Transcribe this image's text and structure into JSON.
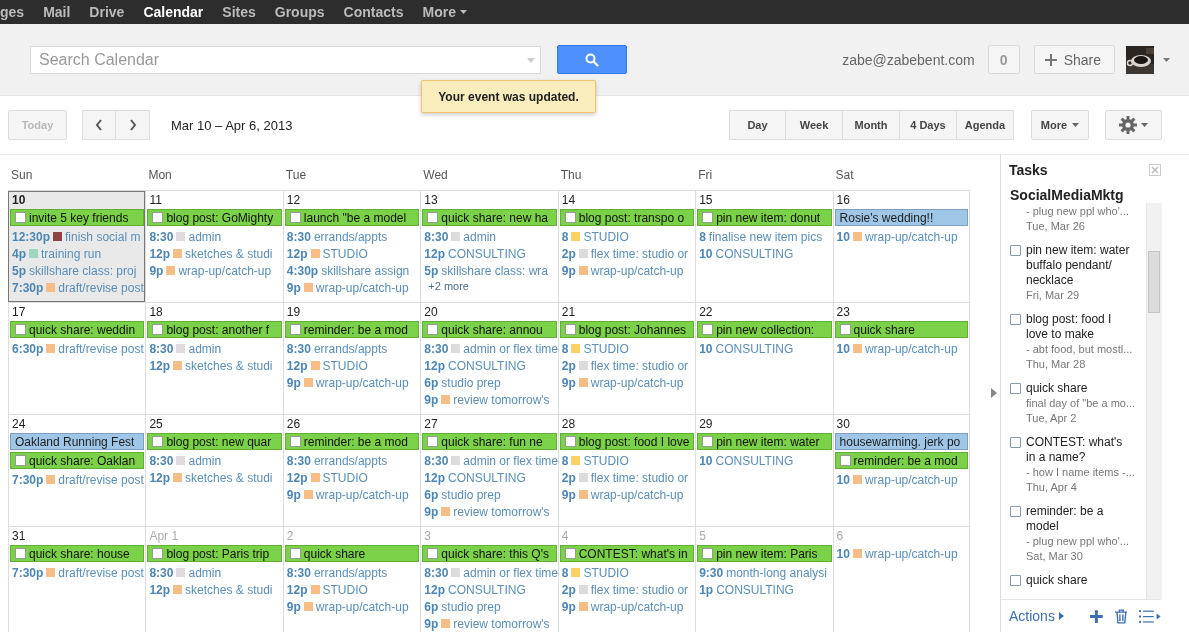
{
  "nav": [
    {
      "label": "ges",
      "selected": false
    },
    {
      "label": "Mail",
      "selected": false
    },
    {
      "label": "Drive",
      "selected": false
    },
    {
      "label": "Calendar",
      "selected": true
    },
    {
      "label": "Sites",
      "selected": false
    },
    {
      "label": "Groups",
      "selected": false
    },
    {
      "label": "Contacts",
      "selected": false
    },
    {
      "label": "More",
      "selected": false
    }
  ],
  "header": {
    "search_placeholder": "Search Calendar",
    "email": "zabe@zabebent.com",
    "notifications": "0",
    "share": "Share",
    "toast": "Your event was updated."
  },
  "toolbar": {
    "today": {
      "label": "Today",
      "disabled": true
    },
    "date_range": "Mar 10 – Apr 6, 2013",
    "views": [
      "Day",
      "Week",
      "Month",
      "4 Days",
      "Agenda"
    ],
    "more": "More"
  },
  "weekdays": [
    "Sun",
    "Mon",
    "Tue",
    "Wed",
    "Thu",
    "Fri",
    "Sat"
  ],
  "weeks": [
    {
      "days": [
        {
          "date": "10",
          "today": true,
          "other_month": false,
          "events": [
            {
              "kind": "task",
              "text": "invite 5 key friends"
            },
            {
              "kind": "timed",
              "time": "12:30p",
              "text": "finish social m",
              "color": "#8e4343"
            },
            {
              "kind": "timed",
              "time": "4p",
              "text": "training run",
              "color": "#9fd6c2"
            },
            {
              "kind": "timed",
              "time": "5p",
              "text": "skillshare class: proj"
            },
            {
              "kind": "timed",
              "time": "7:30p",
              "text": "draft/revise post",
              "color": "#f6bd86"
            }
          ]
        },
        {
          "date": "11",
          "today": false,
          "other_month": false,
          "events": [
            {
              "kind": "task",
              "text": "blog post: GoMighty"
            },
            {
              "kind": "timed",
              "time": "8:30",
              "text": "admin",
              "color": "#dcdcdc"
            },
            {
              "kind": "timed",
              "time": "12p",
              "text": "sketches & studi",
              "color": "#f6bd86"
            },
            {
              "kind": "timed",
              "time": "9p",
              "text": "wrap-up/catch-up",
              "color": "#f6bd86"
            }
          ]
        },
        {
          "date": "12",
          "today": false,
          "other_month": false,
          "events": [
            {
              "kind": "task",
              "text": "launch \"be a model"
            },
            {
              "kind": "timed",
              "time": "8:30",
              "text": "errands/appts"
            },
            {
              "kind": "timed",
              "time": "12p",
              "text": "STUDIO",
              "color": "#f6bd86"
            },
            {
              "kind": "timed",
              "time": "4:30p",
              "text": "skillshare assign"
            },
            {
              "kind": "timed",
              "time": "9p",
              "text": "wrap-up/catch-up",
              "color": "#f6bd86"
            }
          ]
        },
        {
          "date": "13",
          "today": false,
          "other_month": false,
          "events": [
            {
              "kind": "task",
              "text": "quick share: new ha"
            },
            {
              "kind": "timed",
              "time": "8:30",
              "text": "admin",
              "color": "#dcdcdc"
            },
            {
              "kind": "timed",
              "time": "12p",
              "text": "CONSULTING"
            },
            {
              "kind": "timed",
              "time": "5p",
              "text": "skillshare class: wra"
            },
            {
              "kind": "more",
              "text": "+2 more"
            }
          ]
        },
        {
          "date": "14",
          "today": false,
          "other_month": false,
          "events": [
            {
              "kind": "task",
              "text": "blog post: transpo o"
            },
            {
              "kind": "timed",
              "time": "8",
              "text": "STUDIO",
              "color": "#fad165"
            },
            {
              "kind": "timed",
              "time": "2p",
              "text": "flex time: studio or",
              "color": "#dcdcdc"
            },
            {
              "kind": "timed",
              "time": "9p",
              "text": "wrap-up/catch-up",
              "color": "#f6bd86"
            }
          ]
        },
        {
          "date": "15",
          "today": false,
          "other_month": false,
          "events": [
            {
              "kind": "task",
              "text": "pin new item: donut"
            },
            {
              "kind": "timed",
              "time": "8",
              "text": "finalise new item pics"
            },
            {
              "kind": "timed",
              "time": "10",
              "text": "CONSULTING"
            }
          ]
        },
        {
          "date": "16",
          "today": false,
          "other_month": false,
          "events": [
            {
              "kind": "allday",
              "text": "Rosie's wedding!!"
            },
            {
              "kind": "timed",
              "time": "10",
              "text": "wrap-up/catch-up",
              "color": "#f6bd86"
            }
          ]
        }
      ]
    },
    {
      "days": [
        {
          "date": "17",
          "today": false,
          "other_month": false,
          "events": [
            {
              "kind": "task",
              "text": "quick share: weddin"
            },
            {
              "kind": "timed",
              "time": "6:30p",
              "text": "draft/revise post",
              "color": "#f6bd86"
            }
          ]
        },
        {
          "date": "18",
          "today": false,
          "other_month": false,
          "events": [
            {
              "kind": "task",
              "text": "blog post: another f"
            },
            {
              "kind": "timed",
              "time": "8:30",
              "text": "admin",
              "color": "#dcdcdc"
            },
            {
              "kind": "timed",
              "time": "12p",
              "text": "sketches & studi",
              "color": "#f6bd86"
            }
          ]
        },
        {
          "date": "19",
          "today": false,
          "other_month": false,
          "events": [
            {
              "kind": "task",
              "text": "reminder: be a mod"
            },
            {
              "kind": "timed",
              "time": "8:30",
              "text": "errands/appts"
            },
            {
              "kind": "timed",
              "time": "12p",
              "text": "STUDIO",
              "color": "#f6bd86"
            },
            {
              "kind": "timed",
              "time": "9p",
              "text": "wrap-up/catch-up",
              "color": "#f6bd86"
            }
          ]
        },
        {
          "date": "20",
          "today": false,
          "other_month": false,
          "events": [
            {
              "kind": "task",
              "text": "quick share: annou"
            },
            {
              "kind": "timed",
              "time": "8:30",
              "text": "admin or flex time",
              "color": "#dcdcdc"
            },
            {
              "kind": "timed",
              "time": "12p",
              "text": "CONSULTING"
            },
            {
              "kind": "timed",
              "time": "6p",
              "text": "studio prep"
            },
            {
              "kind": "timed",
              "time": "9p",
              "text": "review tomorrow's",
              "color": "#f6bd86"
            }
          ]
        },
        {
          "date": "21",
          "today": false,
          "other_month": false,
          "events": [
            {
              "kind": "task",
              "text": "blog post: Johannes"
            },
            {
              "kind": "timed",
              "time": "8",
              "text": "STUDIO",
              "color": "#fad165"
            },
            {
              "kind": "timed",
              "time": "2p",
              "text": "flex time: studio or",
              "color": "#dcdcdc"
            },
            {
              "kind": "timed",
              "time": "9p",
              "text": "wrap-up/catch-up",
              "color": "#f6bd86"
            }
          ]
        },
        {
          "date": "22",
          "today": false,
          "other_month": false,
          "events": [
            {
              "kind": "task",
              "text": "pin new collection:"
            },
            {
              "kind": "timed",
              "time": "10",
              "text": "CONSULTING"
            }
          ]
        },
        {
          "date": "23",
          "today": false,
          "other_month": false,
          "events": [
            {
              "kind": "task",
              "text": "quick share"
            },
            {
              "kind": "timed",
              "time": "10",
              "text": "wrap-up/catch-up",
              "color": "#f6bd86"
            }
          ]
        }
      ]
    },
    {
      "days": [
        {
          "date": "24",
          "today": false,
          "other_month": false,
          "events": [
            {
              "kind": "allday",
              "text": "Oakland Running Fest"
            },
            {
              "kind": "task",
              "text": "quick share: Oaklan"
            },
            {
              "kind": "timed",
              "time": "7:30p",
              "text": "draft/revise post",
              "color": "#f6bd86"
            }
          ]
        },
        {
          "date": "25",
          "today": false,
          "other_month": false,
          "events": [
            {
              "kind": "task",
              "text": "blog post: new quar"
            },
            {
              "kind": "timed",
              "time": "8:30",
              "text": "admin",
              "color": "#dcdcdc"
            },
            {
              "kind": "timed",
              "time": "12p",
              "text": "sketches & studi",
              "color": "#f6bd86"
            }
          ]
        },
        {
          "date": "26",
          "today": false,
          "other_month": false,
          "events": [
            {
              "kind": "task",
              "text": "reminder: be a mod"
            },
            {
              "kind": "timed",
              "time": "8:30",
              "text": "errands/appts"
            },
            {
              "kind": "timed",
              "time": "12p",
              "text": "STUDIO",
              "color": "#f6bd86"
            },
            {
              "kind": "timed",
              "time": "9p",
              "text": "wrap-up/catch-up",
              "color": "#f6bd86"
            }
          ]
        },
        {
          "date": "27",
          "today": false,
          "other_month": false,
          "events": [
            {
              "kind": "task",
              "text": "quick share: fun ne"
            },
            {
              "kind": "timed",
              "time": "8:30",
              "text": "admin or flex time",
              "color": "#dcdcdc"
            },
            {
              "kind": "timed",
              "time": "12p",
              "text": "CONSULTING"
            },
            {
              "kind": "timed",
              "time": "6p",
              "text": "studio prep"
            },
            {
              "kind": "timed",
              "time": "9p",
              "text": "review tomorrow's",
              "color": "#f6bd86"
            }
          ]
        },
        {
          "date": "28",
          "today": false,
          "other_month": false,
          "events": [
            {
              "kind": "task",
              "text": "blog post: food I love"
            },
            {
              "kind": "timed",
              "time": "8",
              "text": "STUDIO",
              "color": "#fad165"
            },
            {
              "kind": "timed",
              "time": "2p",
              "text": "flex time: studio or",
              "color": "#dcdcdc"
            },
            {
              "kind": "timed",
              "time": "9p",
              "text": "wrap-up/catch-up",
              "color": "#f6bd86"
            }
          ]
        },
        {
          "date": "29",
          "today": false,
          "other_month": false,
          "events": [
            {
              "kind": "task",
              "text": "pin new item: water"
            },
            {
              "kind": "timed",
              "time": "10",
              "text": "CONSULTING"
            }
          ]
        },
        {
          "date": "30",
          "today": false,
          "other_month": false,
          "events": [
            {
              "kind": "allday",
              "text": "housewarming. jerk po"
            },
            {
              "kind": "task",
              "text": "reminder: be a mod"
            },
            {
              "kind": "timed",
              "time": "10",
              "text": "wrap-up/catch-up",
              "color": "#f6bd86"
            }
          ]
        }
      ]
    },
    {
      "days": [
        {
          "date": "31",
          "today": false,
          "other_month": false,
          "events": [
            {
              "kind": "task",
              "text": "quick share: house"
            },
            {
              "kind": "timed",
              "time": "7:30p",
              "text": "draft/revise post",
              "color": "#f6bd86"
            }
          ]
        },
        {
          "date": "Apr 1",
          "today": false,
          "other_month": true,
          "events": [
            {
              "kind": "task",
              "text": "blog post: Paris trip"
            },
            {
              "kind": "timed",
              "time": "8:30",
              "text": "admin",
              "color": "#dcdcdc"
            },
            {
              "kind": "timed",
              "time": "12p",
              "text": "sketches & studi",
              "color": "#f6bd86"
            }
          ]
        },
        {
          "date": "2",
          "today": false,
          "other_month": true,
          "events": [
            {
              "kind": "task",
              "text": "quick share"
            },
            {
              "kind": "timed",
              "time": "8:30",
              "text": "errands/appts"
            },
            {
              "kind": "timed",
              "time": "12p",
              "text": "STUDIO",
              "color": "#f6bd86"
            },
            {
              "kind": "timed",
              "time": "9p",
              "text": "wrap-up/catch-up",
              "color": "#f6bd86"
            }
          ]
        },
        {
          "date": "3",
          "today": false,
          "other_month": true,
          "events": [
            {
              "kind": "task",
              "text": "quick share: this Q's"
            },
            {
              "kind": "timed",
              "time": "8:30",
              "text": "admin or flex time",
              "color": "#dcdcdc"
            },
            {
              "kind": "timed",
              "time": "12p",
              "text": "CONSULTING"
            },
            {
              "kind": "timed",
              "time": "6p",
              "text": "studio prep"
            },
            {
              "kind": "timed",
              "time": "9p",
              "text": "review tomorrow's",
              "color": "#f6bd86"
            }
          ]
        },
        {
          "date": "4",
          "today": false,
          "other_month": true,
          "events": [
            {
              "kind": "task",
              "text": "CONTEST: what's in"
            },
            {
              "kind": "timed",
              "time": "8",
              "text": "STUDIO",
              "color": "#fad165"
            },
            {
              "kind": "timed",
              "time": "2p",
              "text": "flex time: studio or",
              "color": "#dcdcdc"
            },
            {
              "kind": "timed",
              "time": "9p",
              "text": "wrap-up/catch-up",
              "color": "#f6bd86"
            }
          ]
        },
        {
          "date": "5",
          "today": false,
          "other_month": true,
          "events": [
            {
              "kind": "task",
              "text": "pin new item: Paris"
            },
            {
              "kind": "timed",
              "time": "9:30",
              "text": "month-long analysi"
            },
            {
              "kind": "timed",
              "time": "1p",
              "text": "CONSULTING"
            }
          ]
        },
        {
          "date": "6",
          "today": false,
          "other_month": true,
          "events": [
            {
              "kind": "timed",
              "time": "10",
              "text": "wrap-up/catch-up",
              "color": "#f6bd86"
            }
          ]
        }
      ]
    }
  ],
  "tasks": {
    "title": "Tasks",
    "list_name": "SocialMediaMktg",
    "items": [
      {
        "note": "- plug new ppl who'...",
        "due": "Tue, Mar 26"
      },
      {
        "title": "pin new item: water buffalo pendant/ necklace",
        "due": "Fri, Mar 29",
        "checked": false
      },
      {
        "title": "blog post: food I love to make",
        "note": "- abt food, but mostl...",
        "due": "Thu, Mar 28",
        "checked": false
      },
      {
        "title": "quick share",
        "note": "final day of \"be a mo...",
        "due": "Tue, Apr 2",
        "checked": false
      },
      {
        "title": "CONTEST: what's in a name?",
        "note": "- how I name items -...",
        "due": "Thu, Apr 4",
        "checked": false
      },
      {
        "title": "reminder: be a model",
        "note": "- plug new ppl who'...",
        "due": "Sat, Mar 30",
        "checked": false
      },
      {
        "title": "quick share",
        "checked": false
      }
    ],
    "actions": "Actions"
  }
}
